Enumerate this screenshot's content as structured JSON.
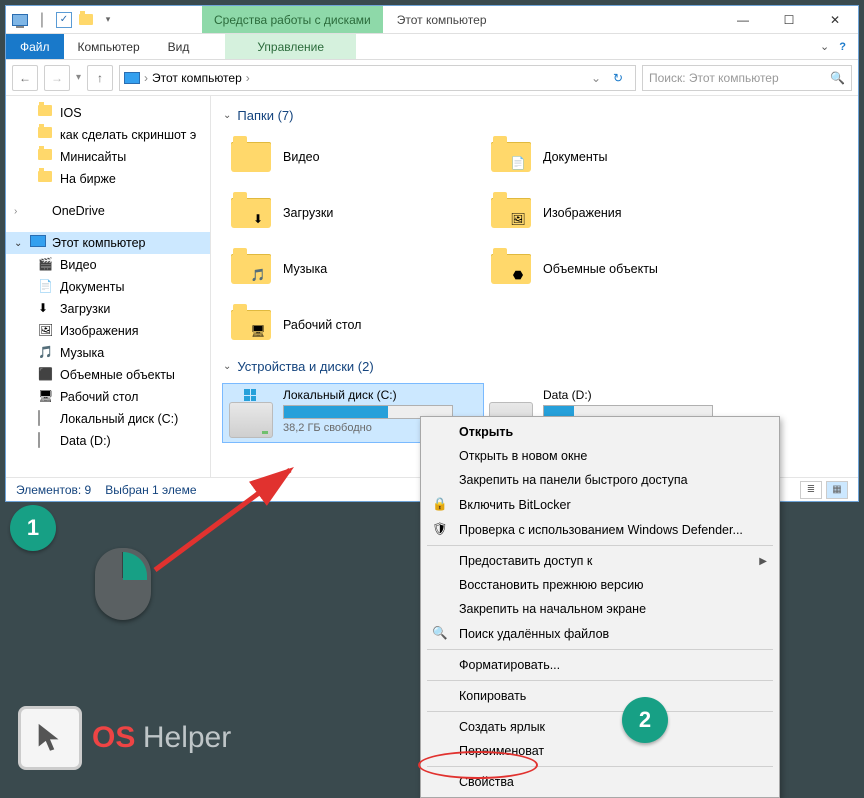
{
  "title_context": "Средства работы с дисками",
  "title": "Этот компьютер",
  "ribbon": {
    "file": "Файл",
    "computer": "Компьютер",
    "view": "Вид",
    "manage": "Управление"
  },
  "breadcrumb": {
    "root": "Этот компьютер"
  },
  "search_placeholder": "Поиск: Этот компьютер",
  "tree": {
    "quick": [
      {
        "label": "IOS"
      },
      {
        "label": "как сделать скриншот э"
      },
      {
        "label": "Минисайты"
      },
      {
        "label": "На бирже"
      }
    ],
    "onedrive": "OneDrive",
    "thispc": "Этот компьютер",
    "pc_children": [
      "Видео",
      "Документы",
      "Загрузки",
      "Изображения",
      "Музыка",
      "Объемные объекты",
      "Рабочий стол",
      "Локальный диск (C:)",
      "Data (D:)"
    ]
  },
  "group_folders": {
    "title": "Папки (7)"
  },
  "folders": [
    {
      "label": "Видео"
    },
    {
      "label": "Документы",
      "tag": "doc"
    },
    {
      "label": "Загрузки",
      "tag": "dl"
    },
    {
      "label": "Изображения",
      "tag": "img"
    },
    {
      "label": "Музыка",
      "tag": "mus"
    },
    {
      "label": "Объемные объекты",
      "tag": "3d"
    },
    {
      "label": "Рабочий стол",
      "tag": "desk"
    }
  ],
  "group_drives": {
    "title": "Устройства и диски (2)"
  },
  "drives": [
    {
      "label": "Локальный диск (C:)",
      "sub": "38,2 ГБ свободно",
      "fill": 62,
      "selected": true
    },
    {
      "label": "Data (D:)",
      "sub": "",
      "fill": 18,
      "selected": false
    }
  ],
  "status": {
    "count": "Элементов: 9",
    "sel": "Выбран 1 элеме"
  },
  "context": [
    {
      "label": "Открыть",
      "bold": true
    },
    {
      "label": "Открыть в новом окне"
    },
    {
      "label": "Закрепить на панели быстрого доступа"
    },
    {
      "label": "Включить BitLocker",
      "icon": "lock"
    },
    {
      "label": "Проверка с использованием Windows Defender...",
      "icon": "shield"
    },
    {
      "sep": true
    },
    {
      "label": "Предоставить доступ к",
      "submenu": true
    },
    {
      "label": "Восстановить прежнюю версию"
    },
    {
      "label": "Закрепить на начальном экране"
    },
    {
      "label": "Поиск удалённых файлов",
      "icon": "search"
    },
    {
      "sep": true
    },
    {
      "label": "Форматировать..."
    },
    {
      "sep": true
    },
    {
      "label": "Копировать"
    },
    {
      "sep": true
    },
    {
      "label": "Создать ярлык"
    },
    {
      "label": "Переименоват"
    },
    {
      "sep": true
    },
    {
      "label": "Свойства",
      "highlight": true
    }
  ],
  "annotations": {
    "one": "1",
    "two": "2"
  },
  "logo": {
    "os": "OS",
    "helper": "Helper"
  }
}
